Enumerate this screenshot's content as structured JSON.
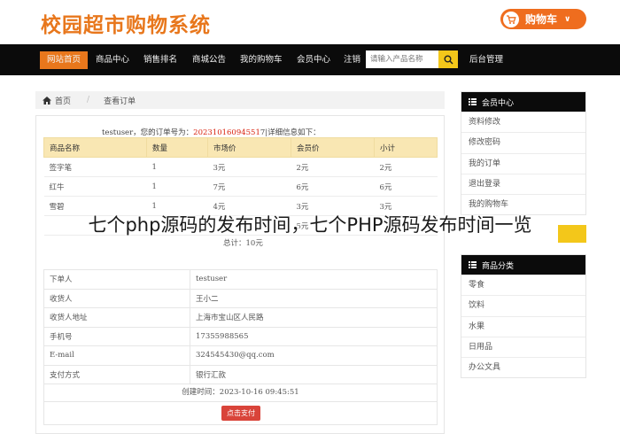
{
  "header": {
    "logo": "校园超市购物系统",
    "cart_label": "购物车",
    "cart_icon": "cart-icon",
    "brand_color": "#e8771c"
  },
  "nav": {
    "items": [
      "网站首页",
      "商品中心",
      "销售排名",
      "商城公告",
      "我的购物车",
      "会员中心",
      "注销"
    ],
    "active": "网站首页",
    "search_placeholder": "请输入产品名称",
    "search_icon": "search-icon",
    "admin": "后台管理"
  },
  "breadcrumb": {
    "home": "首页",
    "current": "查看订单"
  },
  "order": {
    "prefix": "testuser，您的订单号为：",
    "number": "20231016094551",
    "suffix": "7|详细信息如下：",
    "columns": [
      "商品名称",
      "数量",
      "市场价",
      "会员价",
      "小计"
    ],
    "rows": [
      [
        "签字笔",
        "1",
        "3元",
        "2元",
        "2元"
      ],
      [
        "红牛",
        "1",
        "7元",
        "6元",
        "6元"
      ],
      [
        "雪碧",
        "1",
        "4元",
        "3元",
        "3元"
      ],
      [
        "",
        "",
        "",
        "5元",
        ""
      ]
    ],
    "total": "总计：10元"
  },
  "details": {
    "rows": [
      [
        "下单人",
        "testuser"
      ],
      [
        "收货人",
        "王小二"
      ],
      [
        "收货人地址",
        "上海市宝山区人民路"
      ],
      [
        "手机号",
        "17355988565"
      ],
      [
        "E-mail",
        "324545430@qq.com"
      ],
      [
        "支付方式",
        "银行汇款"
      ]
    ],
    "created": "创建时间：2023-10-16 09:45:51",
    "pay_button": "点击支付"
  },
  "sidebar": {
    "member": {
      "title": "会员中心",
      "items": [
        "资料修改",
        "修改密码",
        "我的订单",
        "退出登录",
        "我的购物车"
      ]
    },
    "category": {
      "title": "商品分类",
      "items": [
        "零食",
        "饮料",
        "水果",
        "日用品",
        "办公文具"
      ]
    }
  },
  "overlay": {
    "title": "七个php源码的发布时间，七个PHP源码发布时间一览"
  }
}
